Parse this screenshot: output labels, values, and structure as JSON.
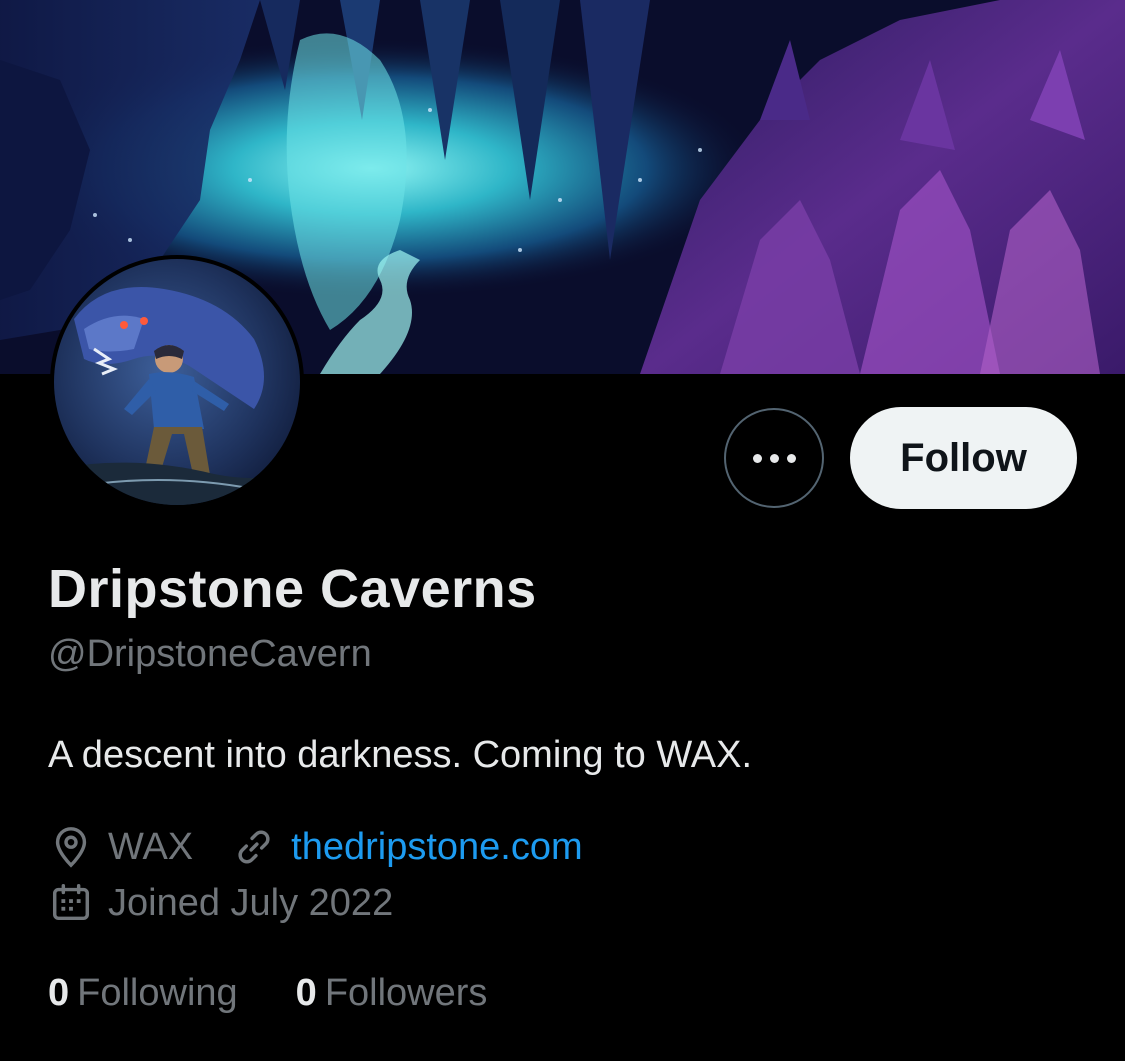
{
  "profile": {
    "display_name": "Dripstone Caverns",
    "handle": "@DripstoneCavern",
    "bio": "A descent into darkness. Coming to WAX.",
    "location": "WAX",
    "website": "thedripstone.com",
    "joined": "Joined July 2022"
  },
  "actions": {
    "follow_label": "Follow",
    "more_icon": "more-dots-icon"
  },
  "stats": {
    "following_count": "0",
    "following_label": "Following",
    "followers_count": "0",
    "followers_label": "Followers"
  },
  "icons": {
    "location": "location-pin-icon",
    "link": "link-icon",
    "calendar": "calendar-icon"
  },
  "colors": {
    "background": "#000000",
    "primary_text": "#e7e9ea",
    "secondary_text": "#71767b",
    "link": "#1d9bf0",
    "follow_button_bg": "#eff3f4",
    "follow_button_text": "#0f1419"
  }
}
